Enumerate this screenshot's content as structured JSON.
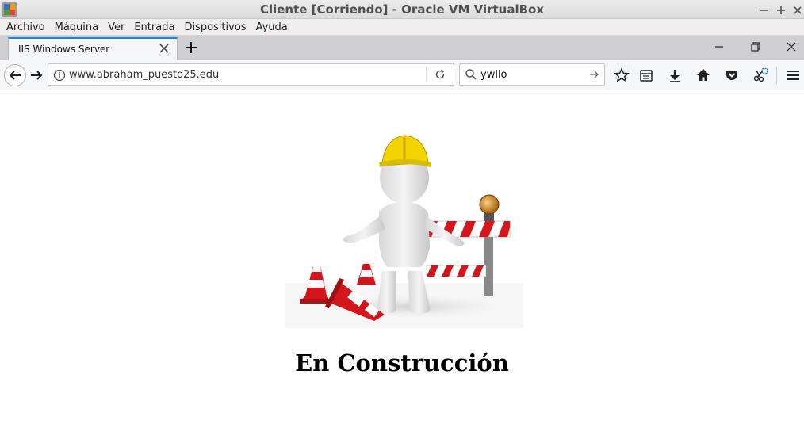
{
  "vbox": {
    "title": "Cliente [Corriendo] - Oracle VM VirtualBox",
    "menu": [
      "Archivo",
      "Máquina",
      "Ver",
      "Entrada",
      "Dispositivos",
      "Ayuda"
    ]
  },
  "browser": {
    "tab_title": "IIS Windows Server",
    "url": "www.abraham_puesto25.edu",
    "search_text": "ywllo"
  },
  "page": {
    "heading": "En Construcción"
  },
  "colors": {
    "tab_accent": "#0a84ff",
    "cone_red": "#d4161c",
    "helmet_yellow": "#f2d400"
  }
}
